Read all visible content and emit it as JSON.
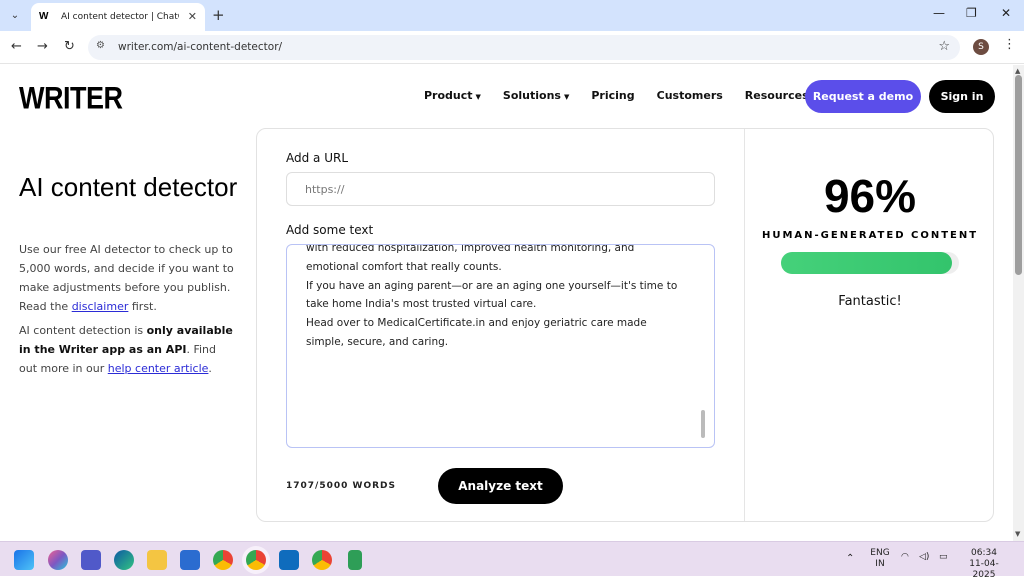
{
  "browser": {
    "tab_title": "AI content detector | ChatGPT d",
    "tab_close": "✕",
    "new_tab": "+",
    "url": "writer.com/ai-content-detector/",
    "profile_initial": "S",
    "icons": [
      "tab-search-icon",
      "close-icon",
      "plus-icon",
      "minimize-icon",
      "restore-icon",
      "back-arrow-icon",
      "forward-arrow-icon",
      "reload-icon",
      "site-info-icon",
      "star-icon",
      "kebab-menu-icon"
    ]
  },
  "header": {
    "logo": "WRITER",
    "nav": [
      {
        "label": "Product",
        "dropdown": true
      },
      {
        "label": "Solutions",
        "dropdown": true
      },
      {
        "label": "Pricing",
        "dropdown": false
      },
      {
        "label": "Customers",
        "dropdown": false
      },
      {
        "label": "Resources",
        "dropdown": true
      }
    ],
    "demo_button": "Request a demo",
    "signin_button": "Sign in",
    "demo_color": "#5b4eea"
  },
  "intro": {
    "title": "AI content detector",
    "desc_before": "Use our free AI detector to check up to 5,000 words, and decide if you want to make adjustments before you publish. Read the ",
    "desc_link": "disclaimer",
    "desc_after": " first.",
    "desc2_before": "AI content detection is ",
    "desc2_bold": "only available in the Writer app as an API",
    "desc2_middle": ". Find out more in our ",
    "desc2_link": "help center article",
    "desc2_after": "."
  },
  "form": {
    "url_label": "Add a URL",
    "url_placeholder": "https://",
    "text_label": "Add some text",
    "text_lines": [
      "with reduced hospitalization, improved health monitoring, and",
      "emotional comfort that really counts.",
      "If you have an aging parent—or are an aging one yourself—it's time to",
      "take home India's most trusted virtual care.",
      "Head over to MedicalCertificate.in and enjoy geriatric care made",
      "simple, secure, and caring."
    ],
    "word_count": "1707/5000 WORDS",
    "analyze_button": "Analyze text"
  },
  "result": {
    "score": "96%",
    "score_fraction": 0.96,
    "label": "HUMAN-GENERATED CONTENT",
    "verdict": "Fantastic!",
    "bar_color": "#3cc872"
  },
  "taskbar": {
    "lang_line1": "ENG",
    "lang_line2": "IN",
    "time": "06:34",
    "date": "11-04-2025"
  }
}
